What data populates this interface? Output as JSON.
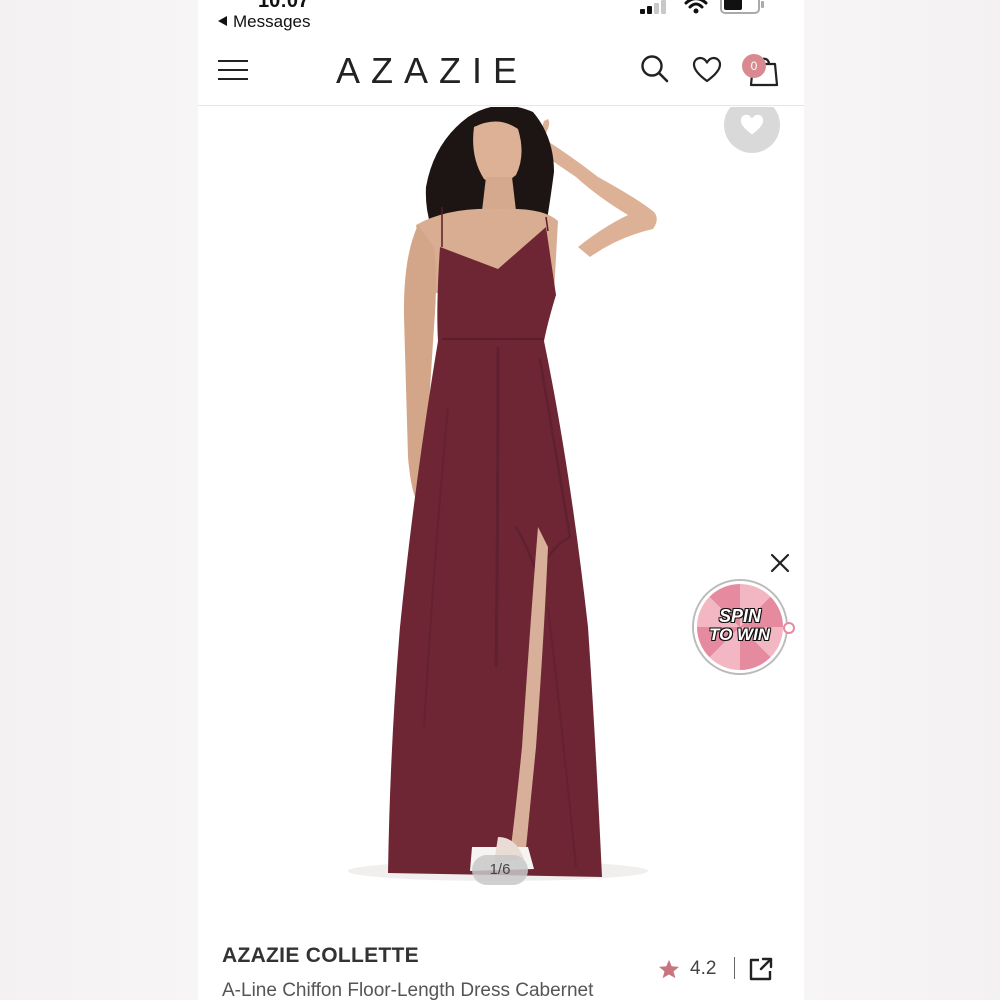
{
  "status_bar": {
    "time": "10:07",
    "back_label": "Messages"
  },
  "header": {
    "brand": "AZAZIE",
    "cart_count": "0"
  },
  "icons": [
    "menu-icon",
    "search-icon",
    "heart-icon",
    "bag-icon",
    "close-icon",
    "share-icon",
    "star-icon"
  ],
  "promo": {
    "line1": "SPIN",
    "line2": "TO WIN"
  },
  "gallery": {
    "pager": "1/6"
  },
  "product": {
    "name": "AZAZIE COLLETTE",
    "subtitle": "A-Line Chiffon Floor-Length Dress Cabernet",
    "rating": "4.2"
  },
  "colors": {
    "cabernet": "#6e2634",
    "accent_pink": "#d98a91",
    "star": "#c9757f"
  }
}
